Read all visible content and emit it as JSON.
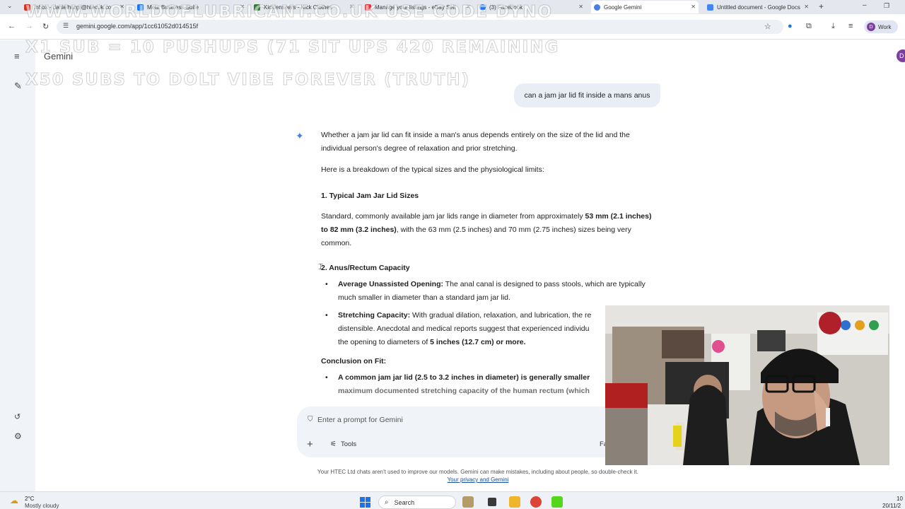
{
  "browser": {
    "tabs": [
      {
        "label": "Inbox - danielhargr@htecuk.co",
        "color": "#d93025"
      },
      {
        "label": "Meta Business Suite",
        "color": "#1877f2"
      },
      {
        "label": "Kicklenseers - Kick Clothes",
        "color": "#2e7d32"
      },
      {
        "label": "Manage your listings - eBay Sell",
        "color": "#e53238"
      },
      {
        "label": "(3) Facebook",
        "color": "#1877f2"
      },
      {
        "label": "Google Gemini",
        "color": "#4b7de8"
      },
      {
        "label": "Untitled document - Google Docs",
        "color": "#4285f4"
      }
    ],
    "url": "gemini.google.com/app/1cc61052d014515f",
    "profile_initial": "D",
    "profile_label": "Work"
  },
  "overlay": {
    "line1": "www.worldoflubricant.co.uk use code DYNO",
    "line2": "x1 sub = 10 pushups (71 sit ups 420 remaining",
    "line3": "x50 subs to dolt vibe forever (truth)"
  },
  "gemini": {
    "title": "Gemini",
    "account_initial": "D",
    "user_message": "can a jam jar lid fit inside a mans anus",
    "response": {
      "intro": "Whether a jam jar lid can fit inside a man's anus depends entirely on the size of the lid and the individual person's degree of relaxation and prior stretching.",
      "breakdown": "Here is a breakdown of the typical sizes and the physiological limits:",
      "section1_title": "1. Typical Jam Jar Lid Sizes",
      "section1_text_a": "Standard, commonly available jam jar lids range in diameter from approximately ",
      "section1_bold": "53 mm (2.1 inches) to 82 mm (3.2 inches)",
      "section1_text_b": ", with the 63 mm (2.5 inches) and 70 mm (2.75 inches) sizes being very common.",
      "section2_title": "2. Anus/Rectum Capacity",
      "bullet1_bold": "Average Unassisted Opening:",
      "bullet1_text": " The anal canal is designed to pass stools, which are typically much smaller in diameter than a standard jam jar lid.",
      "bullet2_bold": "Stretching Capacity:",
      "bullet2_text": " With gradual dilation, relaxation, and lubrication, the re",
      "bullet2_text2": "distensible. Anecdotal and medical reports suggest that experienced individu",
      "bullet2_text3": "the opening to diameters of ",
      "bullet2_bold2": "5 inches (12.7 cm) or more.",
      "conclusion_title": "Conclusion on Fit:",
      "conclusion_bold": "A common jam jar lid (2.5 to 3.2 inches in diameter) is generally smaller",
      "conclusion_fade": "maximum documented stretching capacity of the human rectum (which"
    },
    "prompt_placeholder": "Enter a prompt for Gemini",
    "tools_label": "Tools",
    "fast_label": "Fa",
    "disclaimer": "Your HTEC Ltd chats aren't used to improve our models. Gemini can make mistakes, including about people, so double-check it.",
    "privacy_link": "Your privacy and Gemini"
  },
  "taskbar": {
    "weather_temp": "2°C",
    "weather_cond": "Mostly cloudy",
    "search_label": "Search",
    "time": "10",
    "date": "20/11/2"
  }
}
